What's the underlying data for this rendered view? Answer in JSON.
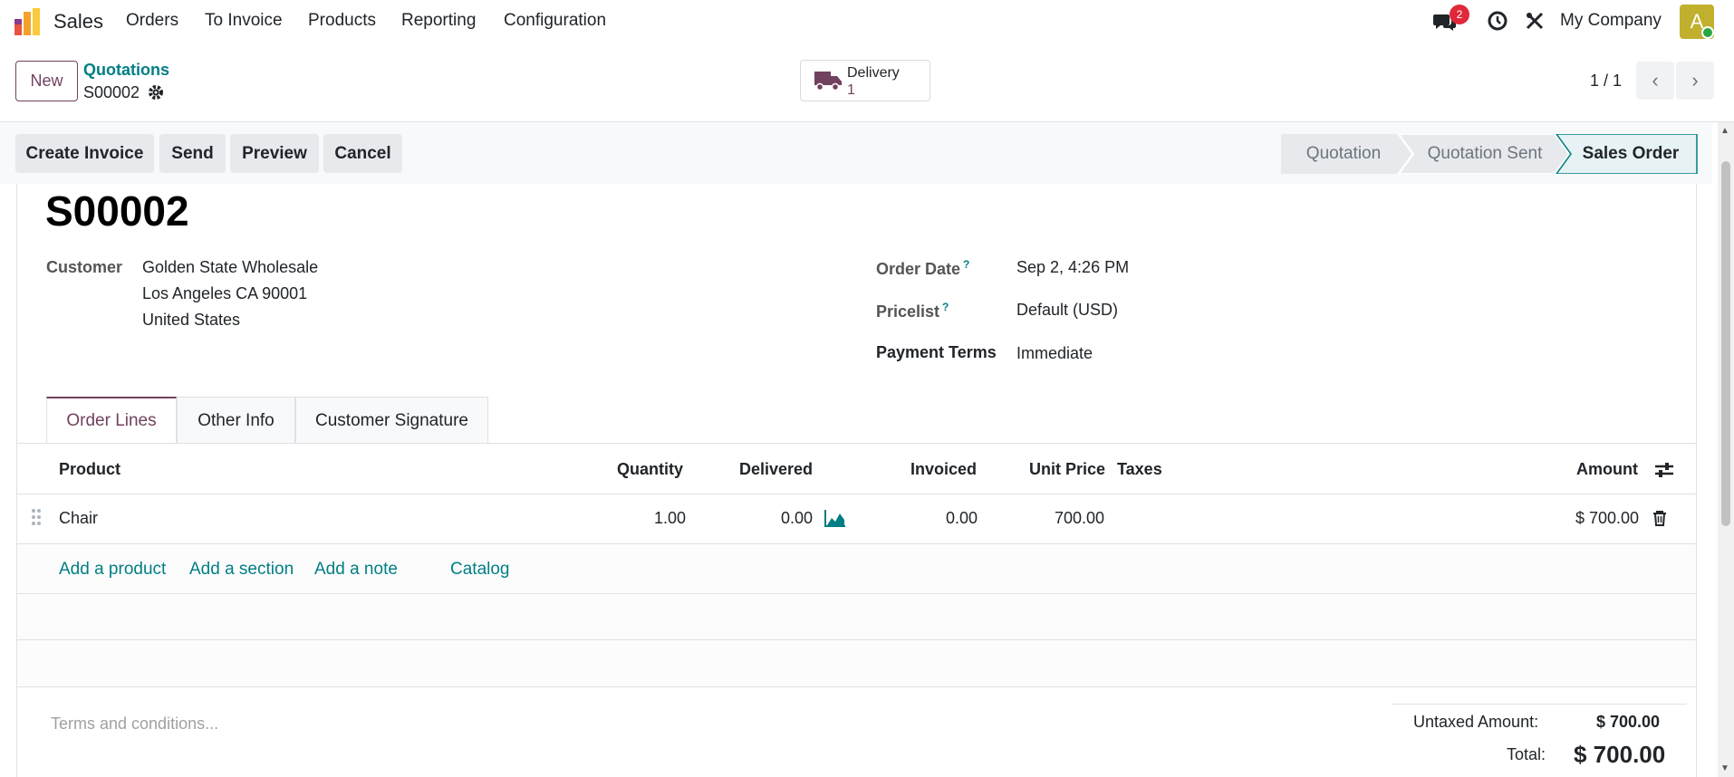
{
  "navbar": {
    "app_name": "Sales",
    "menu": [
      "Orders",
      "To Invoice",
      "Products",
      "Reporting",
      "Configuration"
    ],
    "messages_count": "2",
    "company": "My Company",
    "avatar_letter": "A"
  },
  "control": {
    "new_label": "New",
    "breadcrumb_parent": "Quotations",
    "record_name": "S00002",
    "smart_button": {
      "label": "Delivery",
      "count": "1"
    },
    "pager": "1 / 1"
  },
  "actions": [
    "Create Invoice",
    "Send",
    "Preview",
    "Cancel"
  ],
  "stages": [
    {
      "label": "Quotation",
      "active": false
    },
    {
      "label": "Quotation Sent",
      "active": false
    },
    {
      "label": "Sales Order",
      "active": true
    }
  ],
  "form": {
    "title": "S00002",
    "customer_label": "Customer",
    "customer_name": "Golden State Wholesale",
    "customer_address_1": "Los Angeles CA 90001",
    "customer_address_2": "United States",
    "order_date_label": "Order Date",
    "order_date_help": "?",
    "order_date": "Sep 2, 4:26 PM",
    "pricelist_label": "Pricelist",
    "pricelist_help": "?",
    "pricelist": "Default (USD)",
    "payment_terms_label": "Payment Terms",
    "payment_terms_placeholder": "Immediate"
  },
  "tabs": [
    "Order Lines",
    "Other Info",
    "Customer Signature"
  ],
  "table": {
    "headers": {
      "product": "Product",
      "quantity": "Quantity",
      "delivered": "Delivered",
      "invoiced": "Invoiced",
      "unit_price": "Unit Price",
      "taxes": "Taxes",
      "amount": "Amount"
    },
    "rows": [
      {
        "product": "Chair",
        "quantity": "1.00",
        "delivered": "0.00",
        "invoiced": "0.00",
        "unit_price": "700.00",
        "taxes": "",
        "amount": "$ 700.00"
      }
    ],
    "add_links": [
      "Add a product",
      "Add a section",
      "Add a note",
      "Catalog"
    ]
  },
  "footer": {
    "terms_placeholder": "Terms and conditions...",
    "untaxed_label": "Untaxed Amount:",
    "untaxed_value": "$ 700.00",
    "total_label": "Total:",
    "total_value": "$ 700.00"
  },
  "colors": {
    "brand": "#71415f",
    "link": "#017e84",
    "badge": "#e0283a"
  }
}
